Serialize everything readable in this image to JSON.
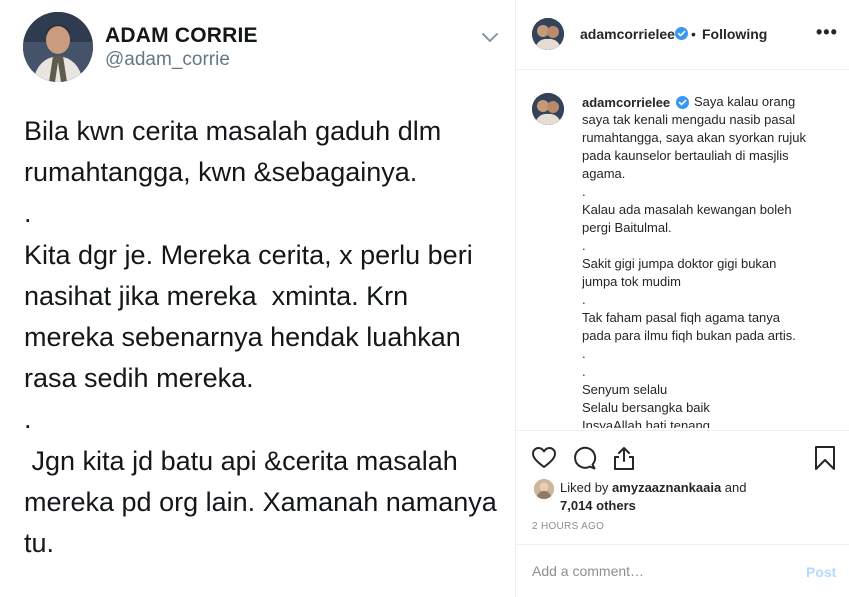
{
  "tweet": {
    "name": "ADAM CORRIE",
    "handle": "@adam_corrie",
    "text": "Bila kwn cerita masalah gaduh dlm\nrumahtangga, kwn &sebagainya.\n.\nKita dgr je. Mereka cerita, x perlu beri\nnasihat jika mereka  xminta. Krn\nmereka sebenarnya hendak luahkan\nrasa sedih mereka.\n.\n Jgn kita jd batu api &cerita masalah\nmereka pd org lain. Xamanah namanya\ntu.",
    "avatar_icon": "profile-photo",
    "menu_icon": "chevron-down-icon"
  },
  "post": {
    "username": "adamcorrielee",
    "dot": "•",
    "follow_status": "Following",
    "more": "•••",
    "verified_color": "#3897f0",
    "caption_user": "adamcorrielee",
    "caption_text": "Saya kalau orang\nsaya tak kenali mengadu nasib pasal\nrumahtangga, saya akan syorkan rujuk\npada kaunselor bertauliah di masjlis\nagama.\n.\nKalau ada masalah kewangan boleh\npergi Baitulmal.\n.\nSakit gigi jumpa doktor gigi bukan\njumpa tok mudim\n.\nTak faham pasal fiqh agama tanya\npada para ilmu fiqh bukan pada artis.\n.\n.\nSenyum selalu\nSelalu bersangka baik\nInsyaAllah hati tenang",
    "liked_by_prefix": "Liked by",
    "liked_by_user": "amyzaaznankaaia",
    "liked_by_and": "and",
    "others": "7,014 others",
    "timestamp": "2 HOURS AGO",
    "comment_placeholder": "Add a comment…",
    "post_label": "Post"
  }
}
